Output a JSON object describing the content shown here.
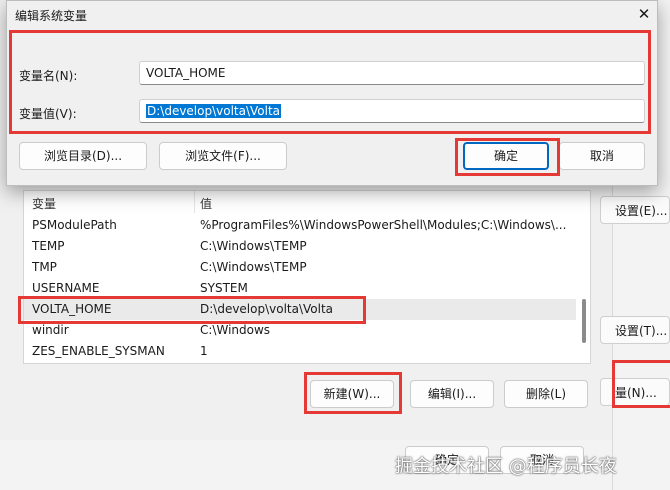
{
  "dialog": {
    "title": "编辑系统变量",
    "close_glyph": "✕",
    "name_label": "变量名(N):",
    "name_value": "VOLTA_HOME",
    "value_label": "变量值(V):",
    "value_value": "D:\\develop\\volta\\Volta",
    "browse_dir": "浏览目录(D)...",
    "browse_file": "浏览文件(F)...",
    "ok": "确定",
    "cancel": "取消"
  },
  "table": {
    "headers": [
      "变量",
      "值"
    ],
    "rows": [
      {
        "name": "PSModulePath",
        "value": "%ProgramFiles%\\WindowsPowerShell\\Modules;C:\\Windows\\..."
      },
      {
        "name": "TEMP",
        "value": "C:\\Windows\\TEMP"
      },
      {
        "name": "TMP",
        "value": "C:\\Windows\\TEMP"
      },
      {
        "name": "USERNAME",
        "value": "SYSTEM"
      },
      {
        "name": "VOLTA_HOME",
        "value": "D:\\develop\\volta\\Volta"
      },
      {
        "name": "windir",
        "value": "C:\\Windows"
      },
      {
        "name": "ZES_ENABLE_SYSMAN",
        "value": "1"
      }
    ]
  },
  "buttons": {
    "new": "新建(W)...",
    "edit": "编辑(I)...",
    "delete": "删除(L)",
    "bottom_ok": "确定",
    "bottom_cancel": "取消"
  },
  "right_panel": {
    "settings1": "设置(E)...",
    "settings2": "设置(T)...",
    "env_vars": "量(N)..."
  },
  "watermark": "掘金技术社区 @程序员长夜"
}
